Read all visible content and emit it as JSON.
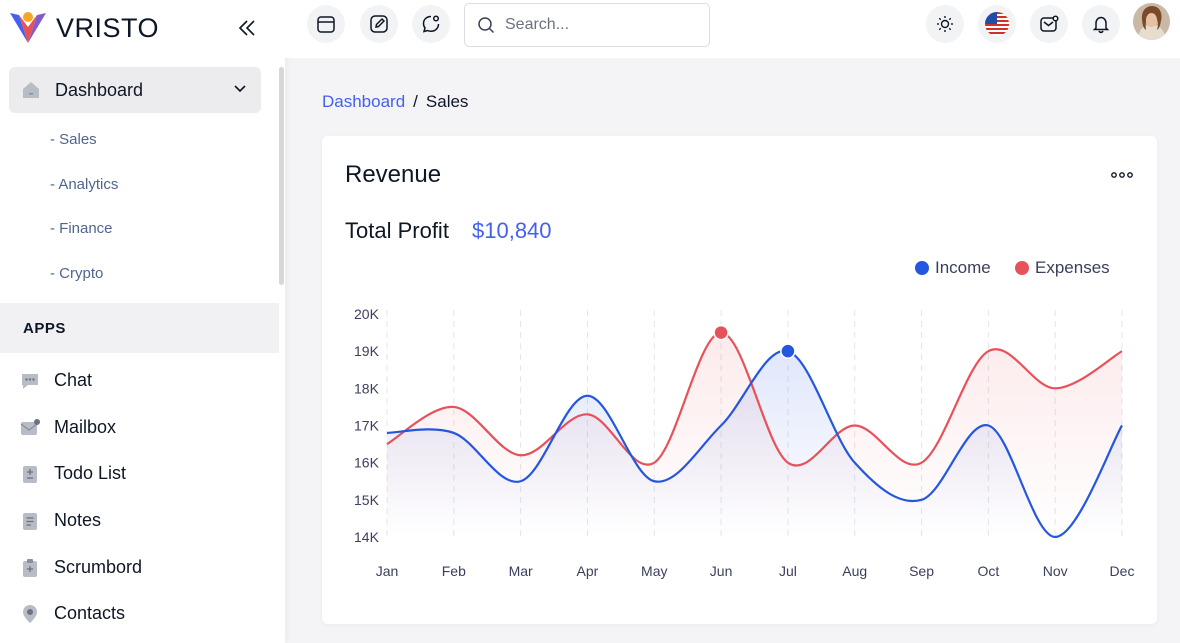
{
  "app": {
    "name": "VRISTO"
  },
  "sidebar": {
    "dashboard": {
      "label": "Dashboard"
    },
    "submenu": [
      "- Sales",
      "- Analytics",
      "- Finance",
      "- Crypto"
    ],
    "apps_heading": "APPS",
    "items": [
      {
        "label": "Chat",
        "icon": "chat-icon"
      },
      {
        "label": "Mailbox",
        "icon": "mailbox-icon"
      },
      {
        "label": "Todo List",
        "icon": "todo-icon"
      },
      {
        "label": "Notes",
        "icon": "notes-icon"
      },
      {
        "label": "Scrumbord",
        "icon": "scrumboard-icon"
      },
      {
        "label": "Contacts",
        "icon": "contacts-icon"
      }
    ]
  },
  "header": {
    "search_placeholder": "Search...",
    "left_buttons": [
      "calendar-icon",
      "edit-icon",
      "chat-bubble-icon"
    ],
    "right_buttons": [
      "sun-icon",
      "us-flag-icon",
      "mail-icon",
      "bell-icon"
    ]
  },
  "breadcrumb": {
    "parent": "Dashboard",
    "separator": "/",
    "current": "Sales"
  },
  "card": {
    "title": "Revenue",
    "profit_label": "Total Profit",
    "profit_value": "$10,840"
  },
  "colors": {
    "income": "#2456e0",
    "expenses": "#e7515a",
    "accent": "#4361ee"
  },
  "chart_data": {
    "type": "area",
    "categories": [
      "Jan",
      "Feb",
      "Mar",
      "Apr",
      "May",
      "Jun",
      "Jul",
      "Aug",
      "Sep",
      "Oct",
      "Nov",
      "Dec"
    ],
    "series": [
      {
        "name": "Income",
        "values": [
          16800,
          16800,
          15500,
          17800,
          15500,
          17000,
          19000,
          16000,
          15000,
          17000,
          14000,
          17000
        ]
      },
      {
        "name": "Expenses",
        "values": [
          16500,
          17500,
          16200,
          17300,
          16000,
          19500,
          16000,
          17000,
          16000,
          19000,
          18000,
          19000
        ]
      }
    ],
    "y_ticks": [
      "14K",
      "15K",
      "16K",
      "17K",
      "18K",
      "19K",
      "20K"
    ],
    "ylim": [
      14000,
      20000
    ],
    "grid": "vertical dashed",
    "legend": "top-right",
    "highlighted_points": [
      {
        "series": "Expenses",
        "category": "Jun"
      },
      {
        "series": "Income",
        "category": "Jul"
      }
    ]
  }
}
